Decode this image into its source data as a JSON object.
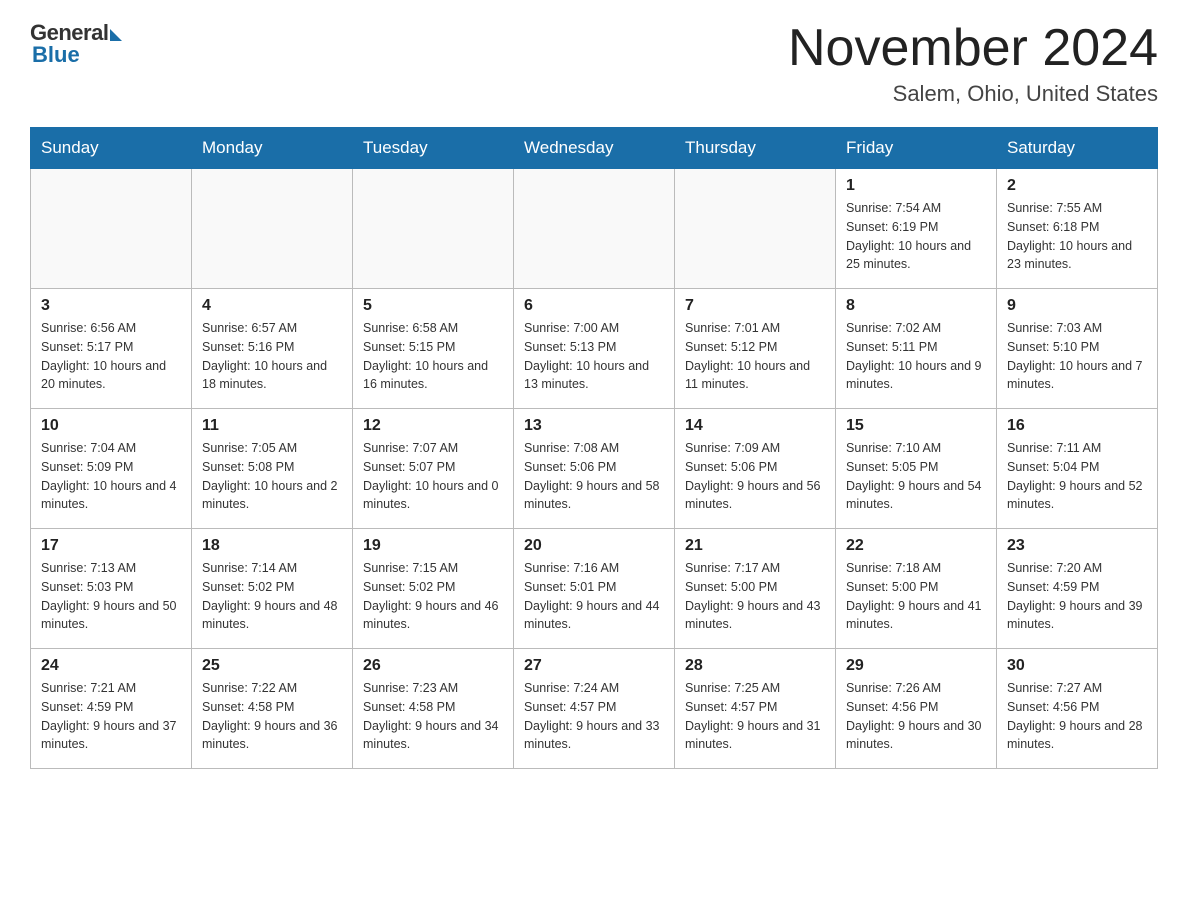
{
  "header": {
    "logo_general": "General",
    "logo_blue": "Blue",
    "month_year": "November 2024",
    "location": "Salem, Ohio, United States"
  },
  "days_of_week": [
    "Sunday",
    "Monday",
    "Tuesday",
    "Wednesday",
    "Thursday",
    "Friday",
    "Saturday"
  ],
  "weeks": [
    [
      {
        "day": "",
        "sunrise": "",
        "sunset": "",
        "daylight": ""
      },
      {
        "day": "",
        "sunrise": "",
        "sunset": "",
        "daylight": ""
      },
      {
        "day": "",
        "sunrise": "",
        "sunset": "",
        "daylight": ""
      },
      {
        "day": "",
        "sunrise": "",
        "sunset": "",
        "daylight": ""
      },
      {
        "day": "",
        "sunrise": "",
        "sunset": "",
        "daylight": ""
      },
      {
        "day": "1",
        "sunrise": "Sunrise: 7:54 AM",
        "sunset": "Sunset: 6:19 PM",
        "daylight": "Daylight: 10 hours and 25 minutes."
      },
      {
        "day": "2",
        "sunrise": "Sunrise: 7:55 AM",
        "sunset": "Sunset: 6:18 PM",
        "daylight": "Daylight: 10 hours and 23 minutes."
      }
    ],
    [
      {
        "day": "3",
        "sunrise": "Sunrise: 6:56 AM",
        "sunset": "Sunset: 5:17 PM",
        "daylight": "Daylight: 10 hours and 20 minutes."
      },
      {
        "day": "4",
        "sunrise": "Sunrise: 6:57 AM",
        "sunset": "Sunset: 5:16 PM",
        "daylight": "Daylight: 10 hours and 18 minutes."
      },
      {
        "day": "5",
        "sunrise": "Sunrise: 6:58 AM",
        "sunset": "Sunset: 5:15 PM",
        "daylight": "Daylight: 10 hours and 16 minutes."
      },
      {
        "day": "6",
        "sunrise": "Sunrise: 7:00 AM",
        "sunset": "Sunset: 5:13 PM",
        "daylight": "Daylight: 10 hours and 13 minutes."
      },
      {
        "day": "7",
        "sunrise": "Sunrise: 7:01 AM",
        "sunset": "Sunset: 5:12 PM",
        "daylight": "Daylight: 10 hours and 11 minutes."
      },
      {
        "day": "8",
        "sunrise": "Sunrise: 7:02 AM",
        "sunset": "Sunset: 5:11 PM",
        "daylight": "Daylight: 10 hours and 9 minutes."
      },
      {
        "day": "9",
        "sunrise": "Sunrise: 7:03 AM",
        "sunset": "Sunset: 5:10 PM",
        "daylight": "Daylight: 10 hours and 7 minutes."
      }
    ],
    [
      {
        "day": "10",
        "sunrise": "Sunrise: 7:04 AM",
        "sunset": "Sunset: 5:09 PM",
        "daylight": "Daylight: 10 hours and 4 minutes."
      },
      {
        "day": "11",
        "sunrise": "Sunrise: 7:05 AM",
        "sunset": "Sunset: 5:08 PM",
        "daylight": "Daylight: 10 hours and 2 minutes."
      },
      {
        "day": "12",
        "sunrise": "Sunrise: 7:07 AM",
        "sunset": "Sunset: 5:07 PM",
        "daylight": "Daylight: 10 hours and 0 minutes."
      },
      {
        "day": "13",
        "sunrise": "Sunrise: 7:08 AM",
        "sunset": "Sunset: 5:06 PM",
        "daylight": "Daylight: 9 hours and 58 minutes."
      },
      {
        "day": "14",
        "sunrise": "Sunrise: 7:09 AM",
        "sunset": "Sunset: 5:06 PM",
        "daylight": "Daylight: 9 hours and 56 minutes."
      },
      {
        "day": "15",
        "sunrise": "Sunrise: 7:10 AM",
        "sunset": "Sunset: 5:05 PM",
        "daylight": "Daylight: 9 hours and 54 minutes."
      },
      {
        "day": "16",
        "sunrise": "Sunrise: 7:11 AM",
        "sunset": "Sunset: 5:04 PM",
        "daylight": "Daylight: 9 hours and 52 minutes."
      }
    ],
    [
      {
        "day": "17",
        "sunrise": "Sunrise: 7:13 AM",
        "sunset": "Sunset: 5:03 PM",
        "daylight": "Daylight: 9 hours and 50 minutes."
      },
      {
        "day": "18",
        "sunrise": "Sunrise: 7:14 AM",
        "sunset": "Sunset: 5:02 PM",
        "daylight": "Daylight: 9 hours and 48 minutes."
      },
      {
        "day": "19",
        "sunrise": "Sunrise: 7:15 AM",
        "sunset": "Sunset: 5:02 PM",
        "daylight": "Daylight: 9 hours and 46 minutes."
      },
      {
        "day": "20",
        "sunrise": "Sunrise: 7:16 AM",
        "sunset": "Sunset: 5:01 PM",
        "daylight": "Daylight: 9 hours and 44 minutes."
      },
      {
        "day": "21",
        "sunrise": "Sunrise: 7:17 AM",
        "sunset": "Sunset: 5:00 PM",
        "daylight": "Daylight: 9 hours and 43 minutes."
      },
      {
        "day": "22",
        "sunrise": "Sunrise: 7:18 AM",
        "sunset": "Sunset: 5:00 PM",
        "daylight": "Daylight: 9 hours and 41 minutes."
      },
      {
        "day": "23",
        "sunrise": "Sunrise: 7:20 AM",
        "sunset": "Sunset: 4:59 PM",
        "daylight": "Daylight: 9 hours and 39 minutes."
      }
    ],
    [
      {
        "day": "24",
        "sunrise": "Sunrise: 7:21 AM",
        "sunset": "Sunset: 4:59 PM",
        "daylight": "Daylight: 9 hours and 37 minutes."
      },
      {
        "day": "25",
        "sunrise": "Sunrise: 7:22 AM",
        "sunset": "Sunset: 4:58 PM",
        "daylight": "Daylight: 9 hours and 36 minutes."
      },
      {
        "day": "26",
        "sunrise": "Sunrise: 7:23 AM",
        "sunset": "Sunset: 4:58 PM",
        "daylight": "Daylight: 9 hours and 34 minutes."
      },
      {
        "day": "27",
        "sunrise": "Sunrise: 7:24 AM",
        "sunset": "Sunset: 4:57 PM",
        "daylight": "Daylight: 9 hours and 33 minutes."
      },
      {
        "day": "28",
        "sunrise": "Sunrise: 7:25 AM",
        "sunset": "Sunset: 4:57 PM",
        "daylight": "Daylight: 9 hours and 31 minutes."
      },
      {
        "day": "29",
        "sunrise": "Sunrise: 7:26 AM",
        "sunset": "Sunset: 4:56 PM",
        "daylight": "Daylight: 9 hours and 30 minutes."
      },
      {
        "day": "30",
        "sunrise": "Sunrise: 7:27 AM",
        "sunset": "Sunset: 4:56 PM",
        "daylight": "Daylight: 9 hours and 28 minutes."
      }
    ]
  ]
}
